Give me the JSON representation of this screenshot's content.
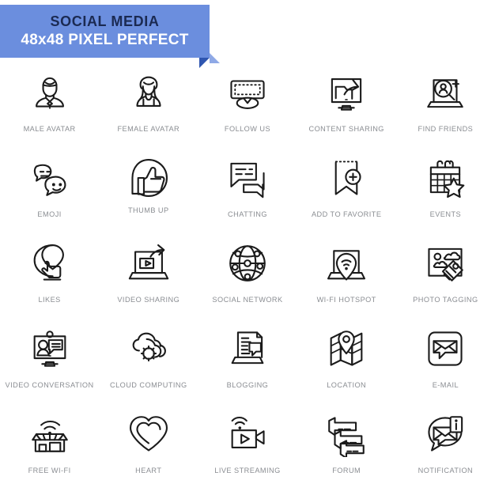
{
  "banner": {
    "title": "SOCIAL MEDIA",
    "subtitle": "48x48 PIXEL PERFECT",
    "bg_color": "#6b8ede",
    "title_color": "#1b2a52",
    "subtitle_color": "#ffffff",
    "fold_color": "#2f56b0"
  },
  "theme": {
    "page_bg": "#ffffff",
    "icon_stroke": "#1b1b1b",
    "label_color": "#8a8d92"
  },
  "grid": {
    "columns": 5,
    "rows": 5,
    "icons": [
      {
        "label": "MALE AVATAR",
        "icon": "male-avatar-icon"
      },
      {
        "label": "FEMALE AVATAR",
        "icon": "female-avatar-icon"
      },
      {
        "label": "FOLLOW US",
        "icon": "follow-us-icon"
      },
      {
        "label": "CONTENT SHARING",
        "icon": "content-sharing-icon"
      },
      {
        "label": "FIND FRIENDS",
        "icon": "find-friends-icon"
      },
      {
        "label": "EMOJI",
        "icon": "emoji-icon"
      },
      {
        "label": "THUMB UP",
        "icon": "thumb-up-icon"
      },
      {
        "label": "CHATTING",
        "icon": "chatting-icon"
      },
      {
        "label": "ADD TO FAVORITE",
        "icon": "add-to-favorite-icon"
      },
      {
        "label": "EVENTS",
        "icon": "events-icon"
      },
      {
        "label": "LIKES",
        "icon": "likes-icon"
      },
      {
        "label": "VIDEO SHARING",
        "icon": "video-sharing-icon"
      },
      {
        "label": "SOCIAL NETWORK",
        "icon": "social-network-icon"
      },
      {
        "label": "WI-FI HOTSPOT",
        "icon": "wifi-hotspot-icon"
      },
      {
        "label": "PHOTO TAGGING",
        "icon": "photo-tagging-icon"
      },
      {
        "label": "VIDEO CONVERSATION",
        "icon": "video-conversation-icon"
      },
      {
        "label": "CLOUD COMPUTING",
        "icon": "cloud-computing-icon"
      },
      {
        "label": "BLOGGING",
        "icon": "blogging-icon"
      },
      {
        "label": "LOCATION",
        "icon": "location-icon"
      },
      {
        "label": "E-MAIL",
        "icon": "email-icon"
      },
      {
        "label": "FREE WI-FI",
        "icon": "free-wifi-icon"
      },
      {
        "label": "HEART",
        "icon": "heart-icon"
      },
      {
        "label": "LIVE STREAMING",
        "icon": "live-streaming-icon"
      },
      {
        "label": "FORUM",
        "icon": "forum-icon"
      },
      {
        "label": "NOTIFICATION",
        "icon": "notification-icon"
      }
    ]
  }
}
